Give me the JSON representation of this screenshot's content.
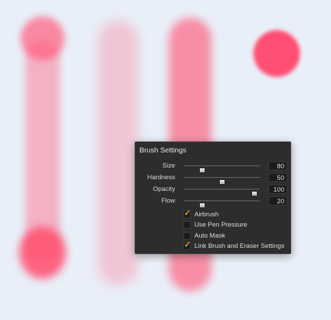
{
  "panel": {
    "title": "Brush Settings",
    "sliders": [
      {
        "label": "Size",
        "value": "80",
        "level": 0.22
      },
      {
        "label": "Hardness",
        "value": "50",
        "level": 0.5
      },
      {
        "label": "Opacity",
        "value": "100",
        "level": 0.97
      },
      {
        "label": "Flow",
        "value": "20",
        "level": 0.22
      }
    ],
    "checkboxes": [
      {
        "label": "Airbrush",
        "checked": true
      },
      {
        "label": "Use Pen Pressure",
        "checked": false
      },
      {
        "label": "Auto Mask",
        "checked": false
      },
      {
        "label": "Link Brush and Eraser Settings",
        "checked": true
      }
    ]
  },
  "colors": {
    "stroke": "#ff4f74",
    "panel_bg": "#2d2d2d",
    "checkmark": "#f29a2e",
    "canvas_bg": "#e9eff8"
  },
  "icons": {
    "checkmark": "checkmark-icon"
  }
}
